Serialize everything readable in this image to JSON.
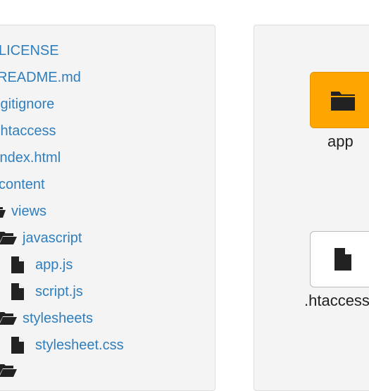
{
  "tree": {
    "items": [
      {
        "label": "LICENSE"
      },
      {
        "label": "README.md"
      },
      {
        "label": ".gitignore"
      },
      {
        "label": ".htaccess"
      },
      {
        "label": "index.html"
      },
      {
        "label": "content"
      },
      {
        "label": "views"
      },
      {
        "label": "javascript"
      },
      {
        "label": "app.js"
      },
      {
        "label": "script.js"
      },
      {
        "label": "stylesheets"
      },
      {
        "label": "stylesheet.css"
      }
    ]
  },
  "grid": {
    "tiles": [
      {
        "label": "app",
        "icon": "folder-icon",
        "color": "#ffa500"
      },
      {
        "label": ".htaccess",
        "icon": "file-icon",
        "color": "#ffffff"
      }
    ]
  }
}
